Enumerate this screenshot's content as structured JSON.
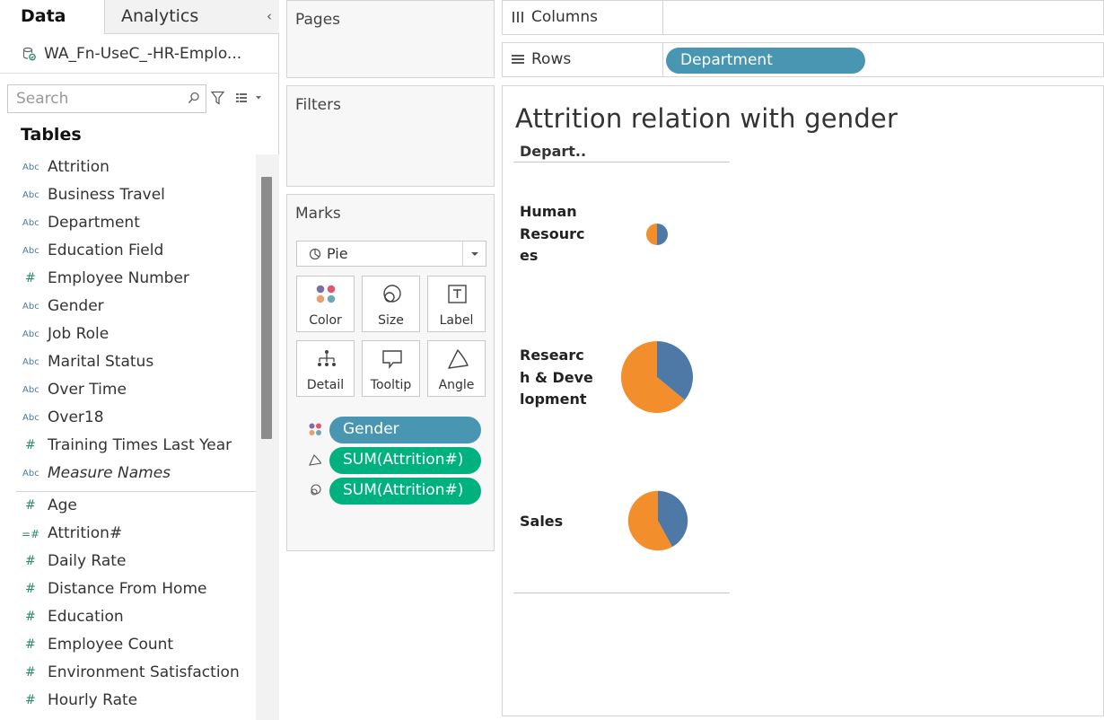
{
  "left_pane": {
    "tab_data": "Data",
    "tab_analytics": "Analytics",
    "collapse": "‹",
    "datasource": "WA_Fn-UseC_-HR-Emplo...",
    "search_placeholder": "Search",
    "tables_heading": "Tables",
    "dimensions": [
      {
        "type": "Abc",
        "label": "Attrition"
      },
      {
        "type": "Abc",
        "label": "Business Travel"
      },
      {
        "type": "Abc",
        "label": "Department"
      },
      {
        "type": "Abc",
        "label": "Education Field"
      },
      {
        "type": "#",
        "label": "Employee Number"
      },
      {
        "type": "Abc",
        "label": "Gender"
      },
      {
        "type": "Abc",
        "label": "Job Role"
      },
      {
        "type": "Abc",
        "label": "Marital Status"
      },
      {
        "type": "Abc",
        "label": "Over Time"
      },
      {
        "type": "Abc",
        "label": "Over18"
      },
      {
        "type": "#",
        "label": "Training Times Last Year"
      },
      {
        "type": "Abc",
        "label": "Measure Names"
      }
    ],
    "measures": [
      {
        "type": "#",
        "label": "Age"
      },
      {
        "type": "=#",
        "label": "Attrition#"
      },
      {
        "type": "#",
        "label": "Daily Rate"
      },
      {
        "type": "#",
        "label": "Distance From Home"
      },
      {
        "type": "#",
        "label": "Education"
      },
      {
        "type": "#",
        "label": "Employee Count"
      },
      {
        "type": "#",
        "label": "Environment Satisfaction"
      },
      {
        "type": "#",
        "label": "Hourly Rate"
      }
    ]
  },
  "shelves": {
    "pages": "Pages",
    "filters": "Filters",
    "marks": "Marks",
    "mark_type": "Pie",
    "mark_buttons": {
      "color": "Color",
      "size": "Size",
      "label": "Label",
      "detail": "Detail",
      "tooltip": "Tooltip",
      "angle": "Angle"
    },
    "mark_pills": [
      "Gender",
      "SUM(Attrition#)",
      "SUM(Attrition#)"
    ],
    "columns": "Columns",
    "rows": "Rows",
    "rows_pill": "Department"
  },
  "viz": {
    "title": "Attrition relation with gender",
    "column_header": "Depart..",
    "row_labels": [
      [
        "Human",
        "Resourc",
        "es"
      ],
      [
        "Researc",
        "h & Deve",
        "lopment"
      ],
      [
        "Sales"
      ]
    ]
  },
  "chart_data": {
    "type": "pie",
    "title": "Attrition relation with gender",
    "rows": [
      "Human Resources",
      "Research & Development",
      "Sales"
    ],
    "series_colors": {
      "blue": "#4e79a7",
      "orange": "#f28e2b"
    },
    "pies": [
      {
        "row": "Human Resources",
        "relative_size": 0.3,
        "blue_share": 0.5,
        "orange_share": 0.5
      },
      {
        "row": "Research & Development",
        "relative_size": 1.0,
        "blue_share": 0.36,
        "orange_share": 0.64
      },
      {
        "row": "Sales",
        "relative_size": 0.83,
        "blue_share": 0.42,
        "orange_share": 0.58
      }
    ]
  }
}
